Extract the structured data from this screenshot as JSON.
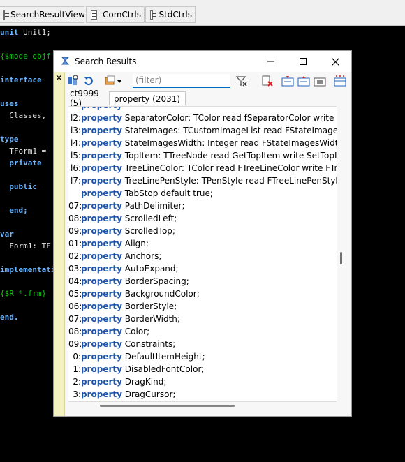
{
  "editor_tabs": [
    {
      "label": "SearchResultView"
    },
    {
      "label": "ComCtrls"
    },
    {
      "label": "StdCtrls"
    }
  ],
  "code_lines": [
    {
      "kw": "unit ",
      "text": "Unit1;",
      "cm": ""
    },
    {
      "kw": "",
      "text": "",
      "cm": "{$mode objf"
    },
    {
      "kw": "interface",
      "text": "",
      "cm": ""
    },
    {
      "kw": "uses",
      "text": "",
      "cm": ""
    },
    {
      "kw": "",
      "text": "  Classes,",
      "cm": ""
    },
    {
      "kw": "type",
      "text": "",
      "cm": ""
    },
    {
      "kw": "",
      "text": "  TForm1 =",
      "cm": ""
    },
    {
      "kw": "  private",
      "text": "",
      "cm": ""
    },
    {
      "kw": "  public",
      "text": "",
      "cm": ""
    },
    {
      "kw": "  end;",
      "text": "",
      "cm": ""
    },
    {
      "kw": "var",
      "text": "",
      "cm": ""
    },
    {
      "kw": "",
      "text": "  Form1: TF",
      "cm": ""
    },
    {
      "kw": "implementati",
      "text": "",
      "cm": ""
    },
    {
      "kw": "",
      "text": "",
      "cm": "{$R *.frm}"
    },
    {
      "kw": "end.",
      "text": "",
      "cm": ""
    }
  ],
  "window": {
    "title": "Search Results",
    "close_panel_label": "✕",
    "filter_placeholder": "(filter)"
  },
  "result_tabs": [
    {
      "label": "ct9999 (5)",
      "active": false
    },
    {
      "label": "property (2031)",
      "active": true
    }
  ],
  "results": [
    {
      "num": "",
      "keyword": "property",
      "text": " SeparatorColor: TColor read fSeparatorColor write SetSepara"
    },
    {
      "num": "l2:",
      "keyword": "property",
      "text": " SeparatorColor: TColor read fSeparatorColor write SetSepara"
    },
    {
      "num": "l3:",
      "keyword": "property",
      "text": " StateImages: TCustomImageList read FStateImages write Se"
    },
    {
      "num": "l4:",
      "keyword": "property",
      "text": " StateImagesWidth: Integer read FStateImagesWidth write Se"
    },
    {
      "num": "l5:",
      "keyword": "property",
      "text": " TopItem: TTreeNode read GetTopItem write SetTopItem;"
    },
    {
      "num": "l6:",
      "keyword": "property",
      "text": " TreeLineColor: TColor read FTreeLineColor write FTreeLineC"
    },
    {
      "num": "l7:",
      "keyword": "property",
      "text": " TreeLinePenStyle: TPenStyle read FTreeLinePenStyle write F1"
    },
    {
      "num": "",
      "keyword": "property",
      "text": " TabStop default true;"
    },
    {
      "num": "07:",
      "keyword": "property",
      "text": " PathDelimiter;"
    },
    {
      "num": "08:",
      "keyword": "property",
      "text": " ScrolledLeft;"
    },
    {
      "num": "09:",
      "keyword": "property",
      "text": " ScrolledTop;"
    },
    {
      "num": "01:",
      "keyword": "property",
      "text": " Align;"
    },
    {
      "num": "02:",
      "keyword": "property",
      "text": " Anchors;"
    },
    {
      "num": "03:",
      "keyword": "property",
      "text": " AutoExpand;"
    },
    {
      "num": "04:",
      "keyword": "property",
      "text": " BorderSpacing;"
    },
    {
      "num": "05:",
      "keyword": "property",
      "text": " BackgroundColor;"
    },
    {
      "num": "06:",
      "keyword": "property",
      "text": " BorderStyle;"
    },
    {
      "num": "07:",
      "keyword": "property",
      "text": " BorderWidth;"
    },
    {
      "num": "08:",
      "keyword": "property",
      "text": " Color;"
    },
    {
      "num": "09:",
      "keyword": "property",
      "text": " Constraints;"
    },
    {
      "num": "0:",
      "keyword": "property",
      "text": " DefaultItemHeight;"
    },
    {
      "num": "1:",
      "keyword": "property",
      "text": " DisabledFontColor;"
    },
    {
      "num": "2:",
      "keyword": "property",
      "text": " DragKind;"
    },
    {
      "num": "3:",
      "keyword": "property",
      "text": " DragCursor;"
    }
  ],
  "colors": {
    "keyword_blue": "#1f55a8",
    "accent": "#0067c0",
    "left_strip": "#f5f2c2"
  }
}
